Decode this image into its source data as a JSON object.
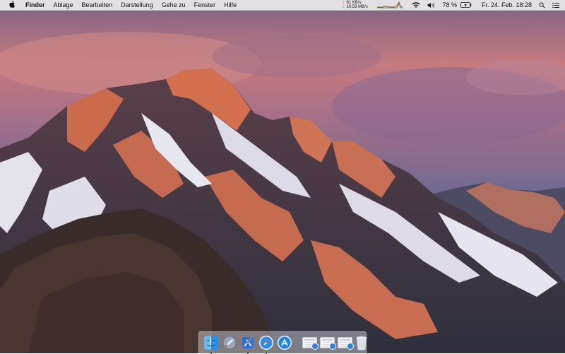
{
  "menubar": {
    "app_name": "Finder",
    "menus": [
      "Ablage",
      "Bearbeiten",
      "Darstellung",
      "Gehe zu",
      "Fenster",
      "Hilfe"
    ],
    "network": {
      "upload": "61 KB/s",
      "download": "10.53 MB/s"
    },
    "battery_percent": "78 %",
    "datetime": "Fr. 24. Feb.  18:28"
  },
  "dock": {
    "apps": [
      {
        "name": "Finder",
        "icon": "finder-icon",
        "running": true
      },
      {
        "name": "Launchpad",
        "icon": "launchpad-icon",
        "running": false
      },
      {
        "name": "Xcode",
        "icon": "xcode-icon",
        "running": true
      },
      {
        "name": "Safari",
        "icon": "safari-icon",
        "running": true
      },
      {
        "name": "App Store",
        "icon": "app-store-icon",
        "running": false
      }
    ],
    "stacks": [
      "document-stack-icon",
      "document-stack-icon",
      "document-stack-icon"
    ],
    "trash": "trash-icon"
  }
}
